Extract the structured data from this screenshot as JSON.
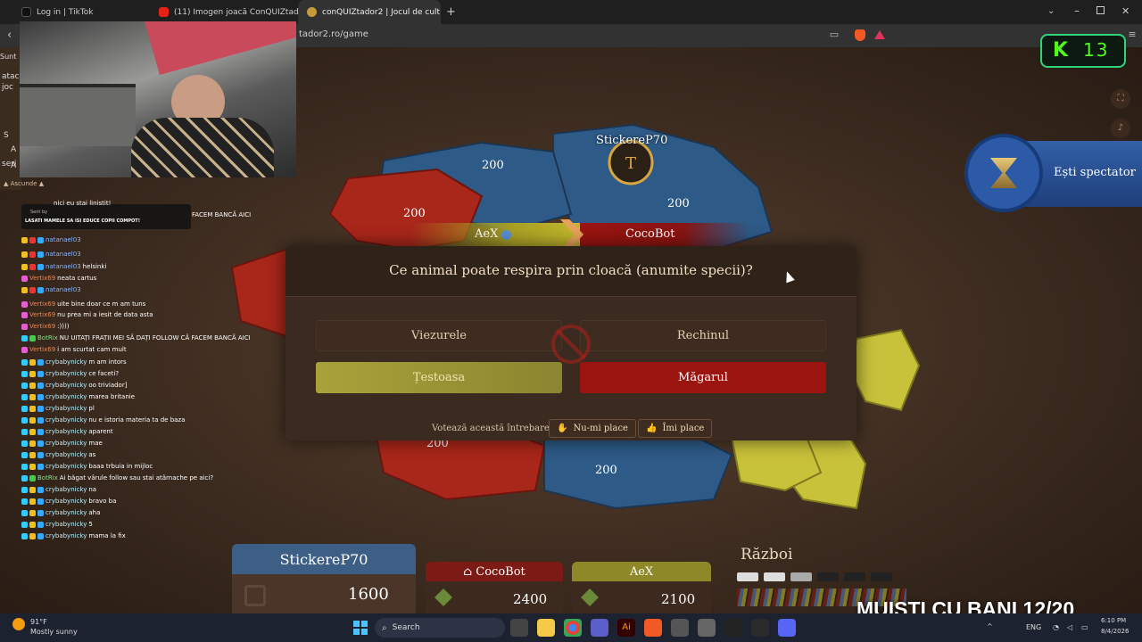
{
  "browser": {
    "tabs": [
      {
        "label": "Log in | TikTok"
      },
      {
        "label": "(11) Imogen joacă ConQUIZtador (m"
      },
      {
        "label": "conQUIZtador2 | Jocul de cult"
      }
    ],
    "new_tab": "+",
    "url": "tador2.ro/game",
    "win_min": "⌄",
    "win_close": "✕"
  },
  "stream": {
    "kick_label": "K",
    "viewers": "13",
    "left_snippets": [
      "Sunt",
      "atac",
      "joc",
      "S",
      "A",
      "A",
      "seri"
    ],
    "ascunde": "▲ Ascunde ▲",
    "sent_by": "Sent by",
    "sent_msg": "LASATI MAMELE SA ISI EDUCE COPII COMPOT!",
    "overlay_text": "MUISTI CU BANI 12/20",
    "chat_top_fragment": "nici eu stai linistit!",
    "chat_top_right": "FACEM BANCĂ AICI",
    "chat": [
      {
        "nick": "natanael03",
        "msg": ""
      },
      {
        "nick": "natanael03",
        "msg": ""
      },
      {
        "nick": "natanael03",
        "msg": "helsinki"
      },
      {
        "nick": "Vertix69",
        "msg": "neata cartus"
      },
      {
        "nick": "natanael03",
        "msg": ""
      },
      {
        "nick": "Vertix69",
        "msg": "uite bine doar ce m am tuns"
      },
      {
        "nick": "Vertix69",
        "msg": "nu prea mi a iesit de data asta"
      },
      {
        "nick": "Vertix69",
        "msg": ":))))"
      },
      {
        "nick": "BotRix",
        "msg": "NU UITAȚI FRAȚII MEI SĂ DAȚI FOLLOW CĂ FACEM BANCĂ AICI"
      },
      {
        "nick": "Vertix69",
        "msg": "i am scurtat cam mult"
      },
      {
        "nick": "crybabynicky",
        "msg": "m am intors"
      },
      {
        "nick": "crybabynicky",
        "msg": "ce faceti?"
      },
      {
        "nick": "crybabynicky",
        "msg": "oo triviador]"
      },
      {
        "nick": "crybabynicky",
        "msg": "marea britanie"
      },
      {
        "nick": "crybabynicky",
        "msg": "pl"
      },
      {
        "nick": "crybabynicky",
        "msg": "nu e istoria materia ta de baza"
      },
      {
        "nick": "crybabynicky",
        "msg": "aparent"
      },
      {
        "nick": "crybabynicky",
        "msg": "mae"
      },
      {
        "nick": "crybabynicky",
        "msg": "as"
      },
      {
        "nick": "crybabynicky",
        "msg": "baaa trbuia in mijloc"
      },
      {
        "nick": "BotRix",
        "msg": "Ai băgat vârule follow sau stai atârnache pe aici?"
      },
      {
        "nick": "crybabynicky",
        "msg": "na"
      },
      {
        "nick": "crybabynicky",
        "msg": "bravo ba"
      },
      {
        "nick": "crybabynicky",
        "msg": "aha"
      },
      {
        "nick": "crybabynicky",
        "msg": "5"
      },
      {
        "nick": "crybabynicky",
        "msg": "mama la fix"
      }
    ]
  },
  "game": {
    "map_player_label": "StickereP70",
    "region_values": [
      "200",
      "200",
      "200",
      "200",
      "200"
    ],
    "spectator_label": "Ești spectator",
    "duel": {
      "left": "AeX",
      "right": "CocoBot"
    },
    "question": "Ce animal poate respira prin cloacă (anumite specii)?",
    "answers": [
      {
        "label": "Viezurele",
        "state": "neutral"
      },
      {
        "label": "Rechinul",
        "state": "neutral"
      },
      {
        "label": "Țestoasa",
        "state": "correct"
      },
      {
        "label": "Măgarul",
        "state": "wrong"
      }
    ],
    "vote_label": "Votează această întrebare:",
    "dislike_label": "Nu-mi place",
    "like_label": "Îmi place",
    "players": [
      {
        "name": "StickereP70",
        "score": "1600"
      },
      {
        "name": "CocoBot",
        "score": "2400"
      },
      {
        "name": "AeX",
        "score": "2100"
      }
    ],
    "phase_label": "Război"
  },
  "taskbar": {
    "temp": "91°F",
    "weather": "Mostly sunny",
    "search": "Search",
    "lang": "ENG",
    "time": "6:10 PM",
    "date": "8/4/2026"
  },
  "colors": {
    "red": "#a8261a",
    "blue": "#2d5a86",
    "yellow": "#c8c13a",
    "gold": "#d8a640",
    "correct": "#a9a23a",
    "wrong": "#9b1410"
  }
}
